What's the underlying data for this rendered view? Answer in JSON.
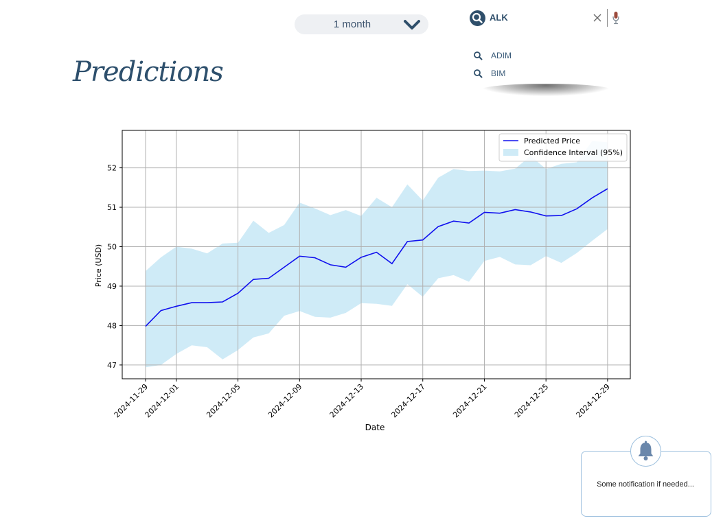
{
  "period_select": {
    "value": "1 month"
  },
  "search": {
    "value": "ALK"
  },
  "suggestions": [
    {
      "label": "ADIM"
    },
    {
      "label": "BIM"
    }
  ],
  "page": {
    "title": "Predictions"
  },
  "colors": {
    "accent": "#2f4f6b",
    "line": "#1010ee",
    "band": "#87ceeb"
  },
  "notification": {
    "text": "Some notification if needed..."
  },
  "chart_data": {
    "type": "line",
    "xlabel": "Date",
    "ylabel": "Price (USD)",
    "ylim": [
      46.65,
      52.95
    ],
    "yticks": [
      47,
      48,
      49,
      50,
      51,
      52
    ],
    "xticks": [
      "2024-11-29",
      "2024-12-01",
      "2024-12-05",
      "2024-12-09",
      "2024-12-13",
      "2024-12-17",
      "2024-12-21",
      "2024-12-25",
      "2024-12-29"
    ],
    "grid": true,
    "legend_position": "top-right",
    "x": [
      "2024-11-29",
      "2024-11-30",
      "2024-12-01",
      "2024-12-02",
      "2024-12-03",
      "2024-12-04",
      "2024-12-05",
      "2024-12-06",
      "2024-12-07",
      "2024-12-08",
      "2024-12-09",
      "2024-12-10",
      "2024-12-11",
      "2024-12-12",
      "2024-12-13",
      "2024-12-14",
      "2024-12-15",
      "2024-12-16",
      "2024-12-17",
      "2024-12-18",
      "2024-12-19",
      "2024-12-20",
      "2024-12-21",
      "2024-12-22",
      "2024-12-23",
      "2024-12-24",
      "2024-12-25",
      "2024-12-26",
      "2024-12-27",
      "2024-12-28",
      "2024-12-29"
    ],
    "series": [
      {
        "name": "Predicted Price",
        "values": [
          47.98,
          48.38,
          48.49,
          48.58,
          48.58,
          48.6,
          48.82,
          49.17,
          49.2,
          49.48,
          49.76,
          49.72,
          49.54,
          49.48,
          49.73,
          49.86,
          49.57,
          50.13,
          50.17,
          50.51,
          50.65,
          50.6,
          50.87,
          50.85,
          50.94,
          50.88,
          50.78,
          50.79,
          50.96,
          51.24,
          51.47
        ]
      },
      {
        "name": "Confidence Interval (95%)",
        "lower": [
          46.94,
          47.0,
          47.28,
          47.5,
          47.45,
          47.14,
          47.38,
          47.7,
          47.8,
          48.25,
          48.37,
          48.22,
          48.2,
          48.32,
          48.57,
          48.55,
          48.5,
          49.05,
          48.73,
          49.2,
          49.28,
          49.11,
          49.64,
          49.74,
          49.55,
          49.53,
          49.76,
          49.59,
          49.84,
          50.15,
          50.45
        ],
        "upper": [
          49.38,
          49.73,
          50.0,
          49.95,
          49.83,
          50.08,
          50.1,
          50.66,
          50.35,
          50.55,
          51.12,
          50.97,
          50.8,
          50.93,
          50.78,
          51.24,
          51.0,
          51.58,
          51.17,
          51.75,
          51.97,
          51.92,
          51.93,
          51.91,
          51.98,
          52.3,
          51.97,
          52.1,
          52.14,
          52.68,
          52.65
        ]
      }
    ]
  }
}
